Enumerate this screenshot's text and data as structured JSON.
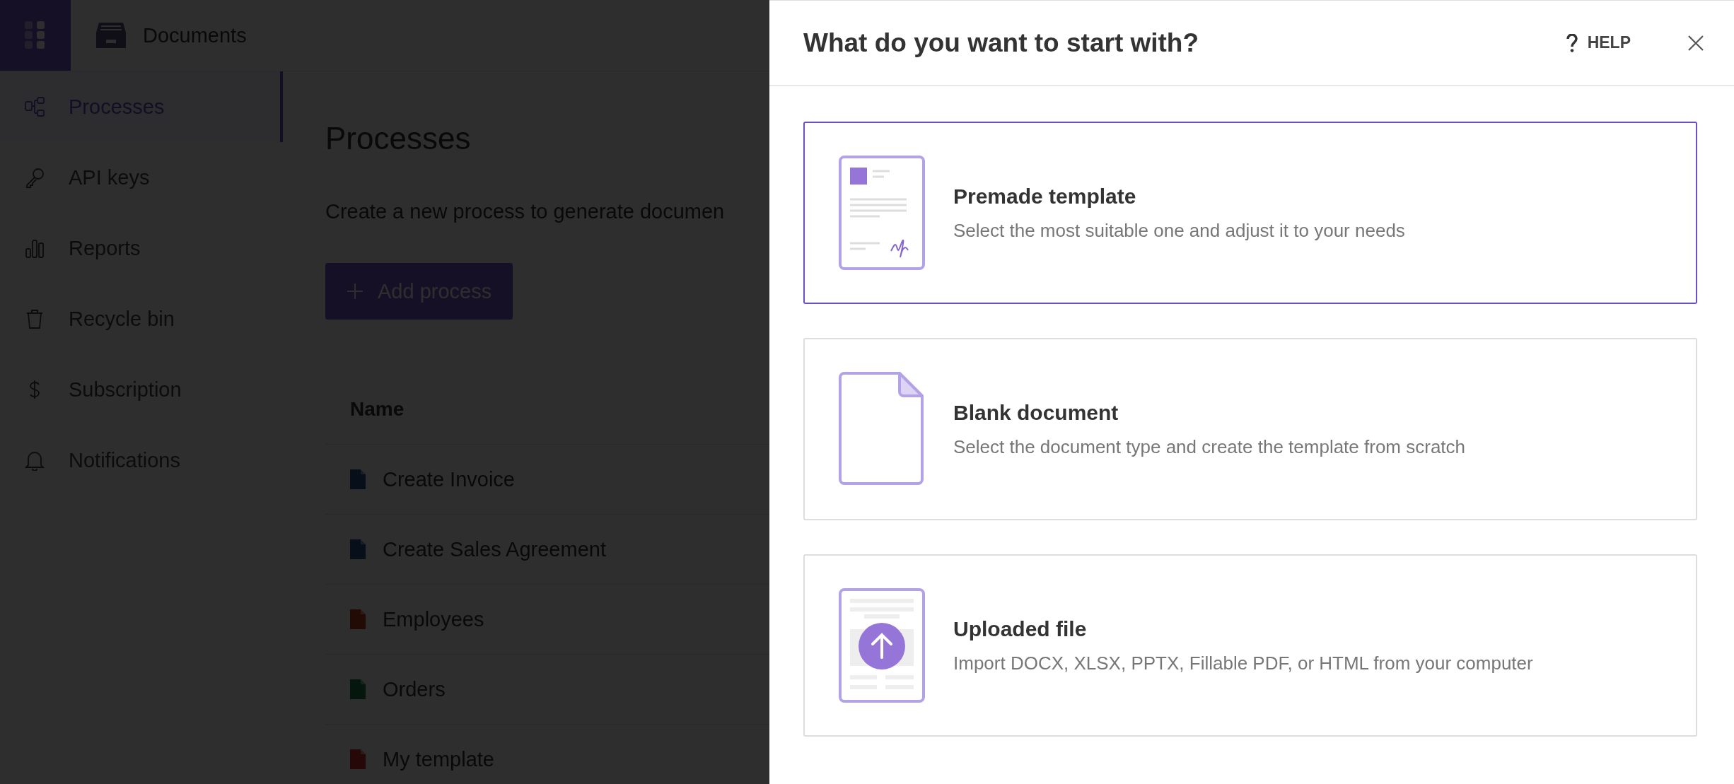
{
  "app": {
    "title": "Documents"
  },
  "sidebar": {
    "items": [
      {
        "label": "Processes",
        "kind": "flow",
        "selected": true
      },
      {
        "label": "API keys",
        "kind": "key",
        "selected": false
      },
      {
        "label": "Reports",
        "kind": "bars",
        "selected": false
      },
      {
        "label": "Recycle bin",
        "kind": "bin",
        "selected": false
      },
      {
        "label": "Subscription",
        "kind": "dollar",
        "selected": false
      },
      {
        "label": "Notifications",
        "kind": "bell",
        "selected": false
      }
    ]
  },
  "main": {
    "title": "Processes",
    "description": "Create a new process to generate documen",
    "add_button": "Add process",
    "table": {
      "columns": [
        "Name"
      ],
      "rows": [
        {
          "name": "Create Invoice",
          "kind": "word"
        },
        {
          "name": "Create Sales Agreement",
          "kind": "word"
        },
        {
          "name": "Employees",
          "kind": "powerpoint"
        },
        {
          "name": "Orders",
          "kind": "excel"
        },
        {
          "name": "My template",
          "kind": "pdf"
        }
      ]
    }
  },
  "dialog": {
    "title": "What do you want to start with?",
    "help": "HELP",
    "options": [
      {
        "kind": "template",
        "title": "Premade template",
        "description": "Select the most suitable one and adjust it to your needs",
        "selected": true
      },
      {
        "kind": "blank",
        "title": "Blank document",
        "description": "Select the document type and create the template from scratch",
        "selected": false
      },
      {
        "kind": "upload",
        "title": "Uploaded file",
        "description": "Import DOCX, XLSX, PPTX, Fillable PDF, or HTML from your computer",
        "selected": false
      }
    ]
  }
}
